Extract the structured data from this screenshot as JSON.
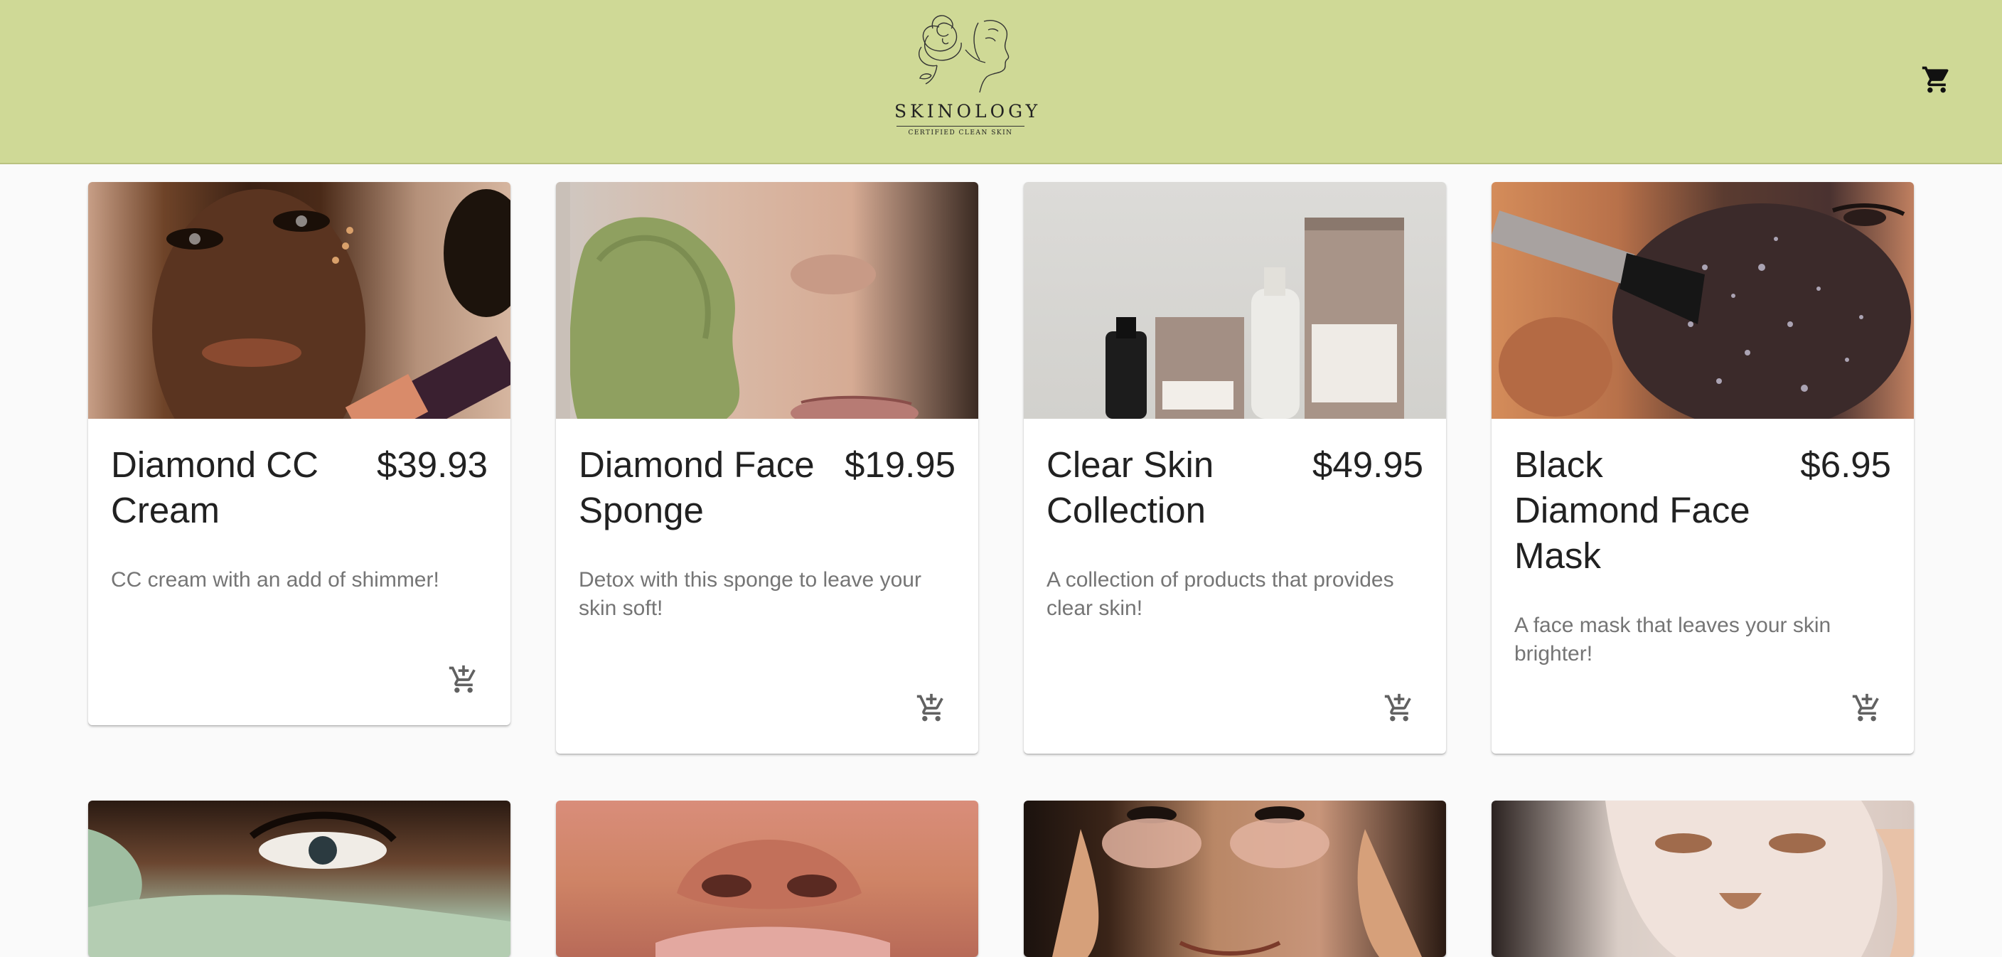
{
  "header": {
    "brand_name": "SKINOLOGY",
    "tagline": "CERTIFIED CLEAN SKIN",
    "background_color": "#cfd996",
    "cart_icon": "shopping-cart-icon"
  },
  "products": [
    {
      "title": "Diamond CC Cream",
      "price": "$39.93",
      "description": "CC cream with an add of shimmer!",
      "image": "woman-holding-cc-cream-tube"
    },
    {
      "title": "Diamond Face Sponge",
      "price": "$19.95",
      "description": "Detox with this sponge to leave your skin soft!",
      "image": "green-face-sponge"
    },
    {
      "title": "Clear Skin Collection",
      "price": "$49.95",
      "description": "A collection of products that provides clear skin!",
      "image": "skincare-bottles-collection"
    },
    {
      "title": "Black Diamond Face Mask",
      "price": "$6.95",
      "description": "A face mask that leaves your skin brighter!",
      "image": "glitter-face-mask-brush"
    },
    {
      "title": "",
      "price": "",
      "description": "",
      "image": "green-clay-mask-eye"
    },
    {
      "title": "",
      "price": "",
      "description": "",
      "image": "nose-lips-closeup"
    },
    {
      "title": "",
      "price": "",
      "description": "",
      "image": "under-eye-patches"
    },
    {
      "title": "",
      "price": "",
      "description": "",
      "image": "sheet-face-mask"
    }
  ],
  "add_to_cart_icon": "add-shopping-cart-icon"
}
